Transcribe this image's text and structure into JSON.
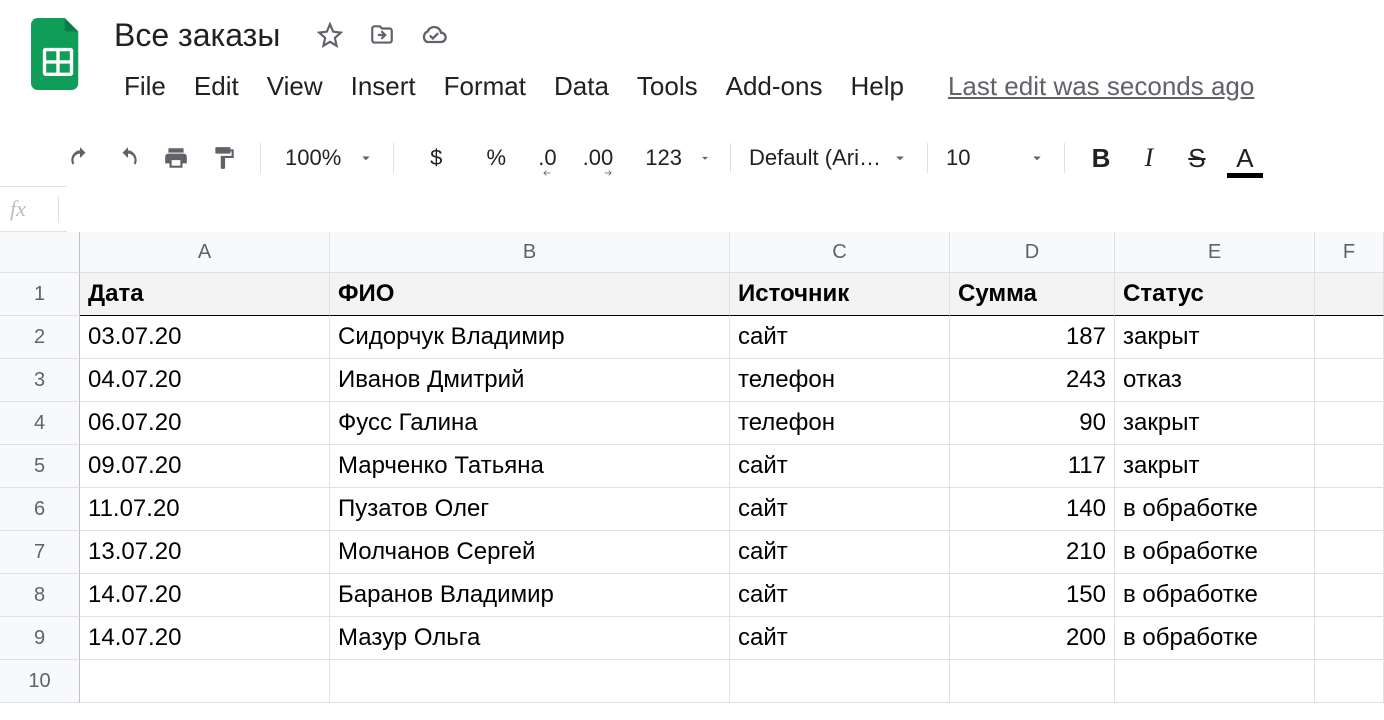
{
  "doc_title": "Все заказы",
  "menu": [
    "File",
    "Edit",
    "View",
    "Insert",
    "Format",
    "Data",
    "Tools",
    "Add-ons",
    "Help"
  ],
  "last_edit": "Last edit was seconds ago",
  "toolbar": {
    "zoom": "100%",
    "currency": "$",
    "percent": "%",
    "dec_dec": ".0",
    "inc_dec": ".00",
    "num_fmt": "123",
    "font": "Default (Ari…",
    "font_size": "10",
    "bold": "B",
    "italic": "I",
    "strike": "S",
    "text_color": "A"
  },
  "fx_label": "fx",
  "fx_value": "",
  "columns": [
    "A",
    "B",
    "C",
    "D",
    "E",
    "F"
  ],
  "row_numbers": [
    "1",
    "2",
    "3",
    "4",
    "5",
    "6",
    "7",
    "8",
    "9",
    "10"
  ],
  "headers": [
    "Дата",
    "ФИО",
    "Источник",
    "Сумма",
    "Статус"
  ],
  "rows": [
    {
      "date": "03.07.20",
      "name": "Сидорчук Владимир",
      "src": "сайт",
      "sum": "187",
      "status": "закрыт"
    },
    {
      "date": "04.07.20",
      "name": "Иванов Дмитрий",
      "src": "телефон",
      "sum": "243",
      "status": "отказ"
    },
    {
      "date": "06.07.20",
      "name": "Фусс Галина",
      "src": "телефон",
      "sum": "90",
      "status": "закрыт"
    },
    {
      "date": "09.07.20",
      "name": "Марченко Татьяна",
      "src": "сайт",
      "sum": "117",
      "status": "закрыт"
    },
    {
      "date": "11.07.20",
      "name": "Пузатов Олег",
      "src": "сайт",
      "sum": "140",
      "status": "в обработке"
    },
    {
      "date": "13.07.20",
      "name": "Молчанов Сергей",
      "src": "сайт",
      "sum": "210",
      "status": "в обработке"
    },
    {
      "date": "14.07.20",
      "name": "Баранов Владимир",
      "src": "сайт",
      "sum": "150",
      "status": "в обработке"
    },
    {
      "date": "14.07.20",
      "name": "Мазур Ольга",
      "src": "сайт",
      "sum": "200",
      "status": "в обработке"
    }
  ]
}
